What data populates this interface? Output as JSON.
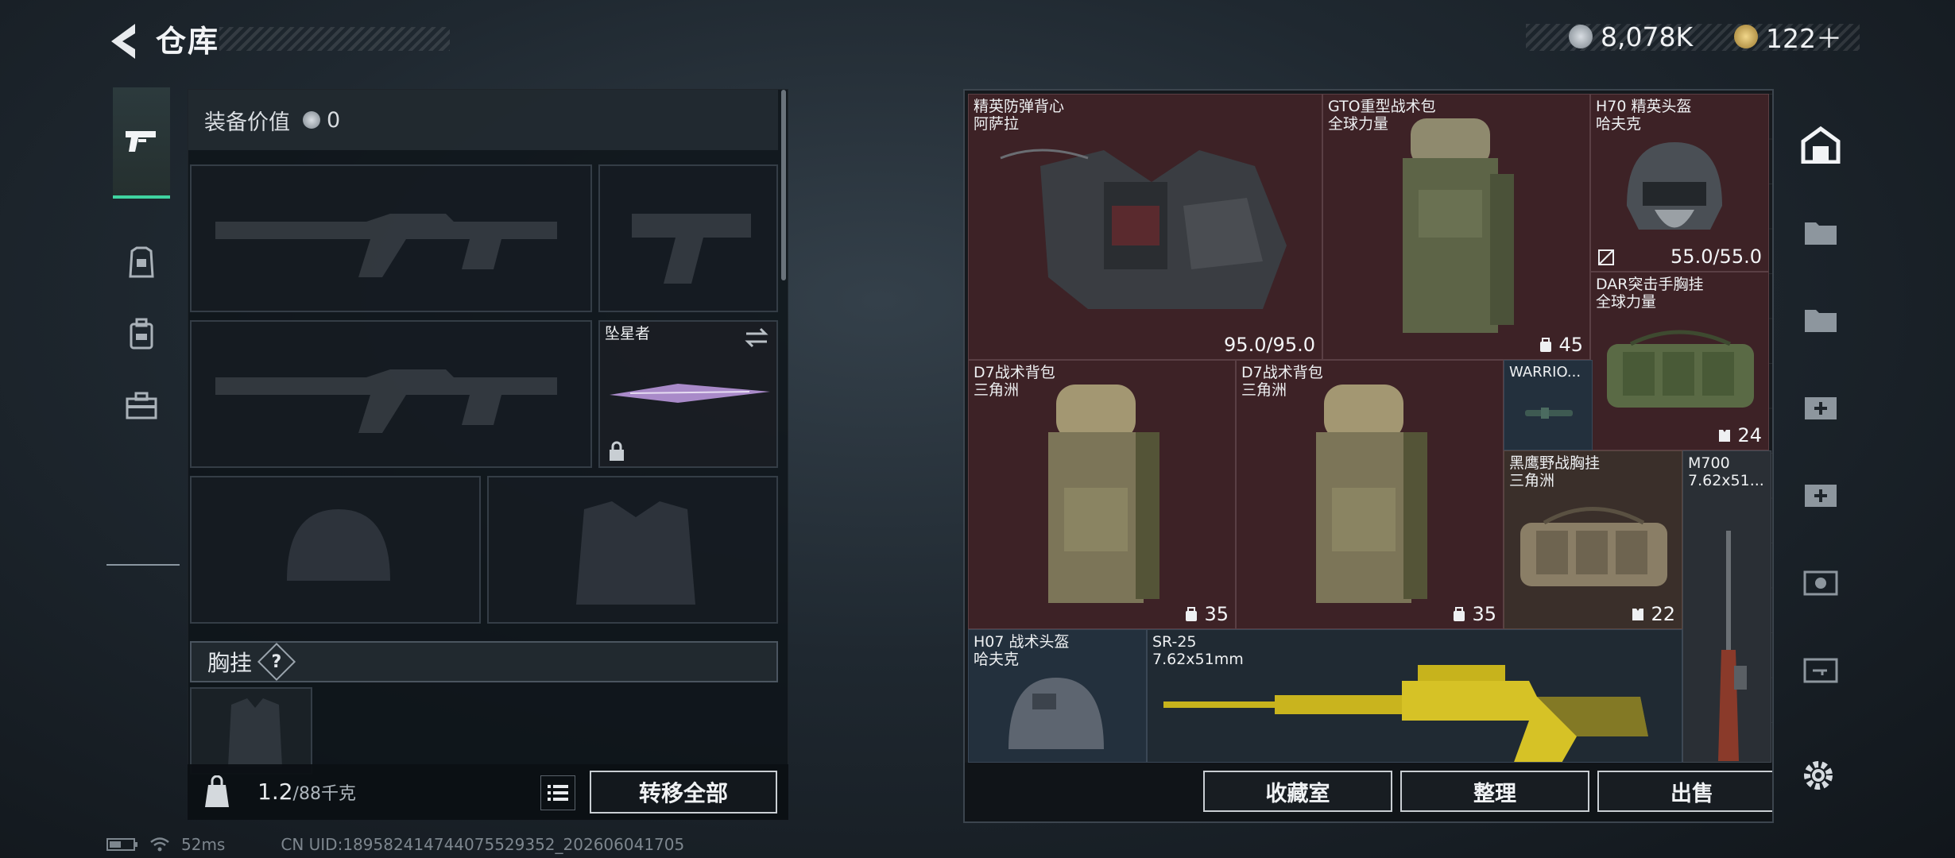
{
  "header": {
    "title": "仓库"
  },
  "currency": {
    "coin_value": "8,078K",
    "token_value": "122＋"
  },
  "loadout": {
    "equip_value_label": "装备价值",
    "equip_value": "0",
    "melee_name": "坠星者",
    "chest_rig_label": "胸挂",
    "chest_help": "?"
  },
  "left_bottom": {
    "weight_value": "1.2",
    "weight_capacity": "/88千克",
    "transfer_all": "转移全部"
  },
  "storage": {
    "items": [
      {
        "name": "精英防弹背心",
        "sub": "阿萨拉",
        "stat": "95.0/95.0"
      },
      {
        "name": "GTO重型战术包",
        "sub": "全球力量",
        "stat": "45"
      },
      {
        "name": "H70 精英头盔",
        "sub": "哈夫克",
        "stat": "55.0/55.0"
      },
      {
        "name": "DAR突击手胸挂",
        "sub": "全球力量",
        "stat": "24"
      },
      {
        "name": "D7战术背包",
        "sub": "三角洲",
        "stat": "35"
      },
      {
        "name": "D7战术背包",
        "sub": "三角洲",
        "stat": "35"
      },
      {
        "name": "WARRIO...",
        "sub": "",
        "stat": ""
      },
      {
        "name": "黑鹰野战胸挂",
        "sub": "三角洲",
        "stat": "22"
      },
      {
        "name": "M700",
        "sub": "7.62x51...",
        "stat": ""
      },
      {
        "name": "H07 战术头盔",
        "sub": "哈夫克",
        "stat": ""
      },
      {
        "name": "SR-25",
        "sub": "7.62x51mm",
        "stat": ""
      }
    ],
    "buttons": {
      "collection": "收藏室",
      "organize": "整理",
      "sell": "出售"
    }
  },
  "status_bar": {
    "ping": "52ms",
    "uid": "CN UID:18958241474407552935​2_202606041705"
  },
  "colors": {
    "accent_green": "#3fd3a0",
    "item_red": "#3d2226",
    "panel": "#15191d"
  }
}
